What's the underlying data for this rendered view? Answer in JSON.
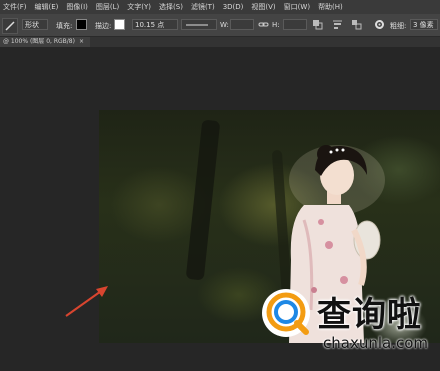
{
  "menu": [
    "文件(F)",
    "编辑(E)",
    "图像(I)",
    "图层(L)",
    "文字(Y)",
    "选择(S)",
    "滤镜(T)",
    "3D(D)",
    "视图(V)",
    "窗口(W)",
    "帮助(H)"
  ],
  "options": {
    "mode": "形状",
    "fill_label": "填充:",
    "stroke_label": "描边:",
    "stroke_width": "10.15 点",
    "w_label": "W:",
    "h_label": "H:",
    "thickness_label": "粗细:",
    "thickness_value": "3 像素"
  },
  "doc_tab": {
    "title": "@ 100% (图层 0, RGB/8)",
    "close": "×"
  },
  "watermark": {
    "title": "查询啦",
    "subtitle": "chaxunla.com"
  },
  "colors": {
    "accent_orange": "#f39c12",
    "accent_blue": "#1e88e5",
    "arrow_red": "#d8452f"
  }
}
